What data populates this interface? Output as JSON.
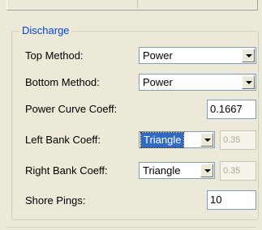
{
  "group": {
    "title": "Discharge"
  },
  "fields": {
    "top_method": {
      "label": "Top Method:",
      "value": "Power"
    },
    "bottom_method": {
      "label": "Bottom Method:",
      "value": "Power"
    },
    "power_curve_coeff": {
      "label": "Power Curve Coeff:",
      "value": "0.1667"
    },
    "left_bank_coeff": {
      "label": "Left Bank Coeff:",
      "value": "Triangle",
      "coeff_value": "0.35"
    },
    "right_bank_coeff": {
      "label": "Right Bank Coeff:",
      "value": "Triangle",
      "coeff_value": "0.35"
    },
    "shore_pings": {
      "label": "Shore Pings:",
      "value": "10"
    }
  },
  "icons": {
    "dropdown": "chevron-down-icon"
  }
}
